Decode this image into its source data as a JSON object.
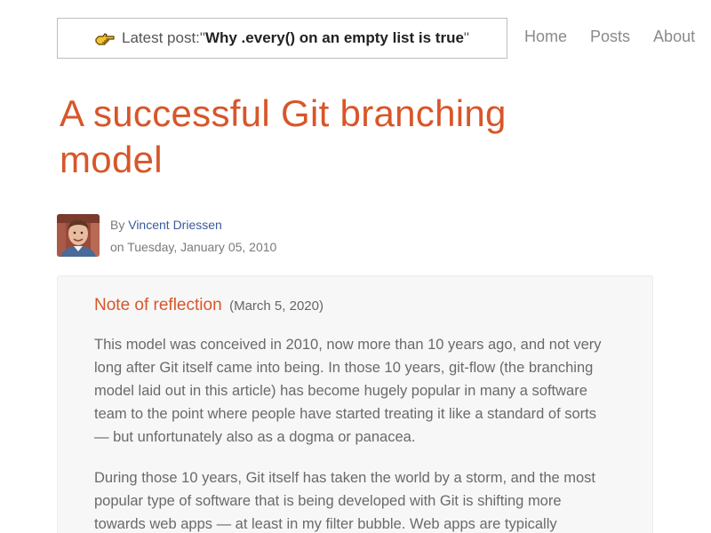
{
  "header": {
    "latest_prefix": "Latest post: ",
    "latest_quote_open": "\"",
    "latest_title": "Why .every() on an empty list is true",
    "latest_quote_close": "\"",
    "latest_icon": "pointing-hand-icon"
  },
  "nav": {
    "items": [
      {
        "label": "Home"
      },
      {
        "label": "Posts"
      },
      {
        "label": "About"
      }
    ]
  },
  "article": {
    "title_line1": "A successful Git branching",
    "title_line2": "model",
    "author_prefix": "By ",
    "author_name": "Vincent Driessen",
    "date_text": "on Tuesday, January 05, 2010"
  },
  "reflection": {
    "title": "Note of reflection",
    "date": "(March 5, 2020)",
    "paragraph1_lines": [
      "This model was conceived in 2010, now more than 10 years ago, and not very",
      "long after Git itself came into being. In those 10 years, git-flow (the branching",
      "model laid out in this article) has become hugely popular in many a software",
      "team to the point where people have started treating it like a standard of sorts",
      "— but unfortunately also as a dogma or panacea."
    ],
    "paragraph2_lines": [
      "During those 10 years, Git itself has taken the world by a storm, and the most",
      "popular type of software that is being developed with Git is shifting more",
      "towards web apps — at least in my filter bubble. Web apps are typically"
    ]
  },
  "colors": {
    "accent": "#d8562a",
    "link": "#3b5b9c",
    "nav": "#8a8a8a",
    "box_bg": "#f7f7f7"
  }
}
